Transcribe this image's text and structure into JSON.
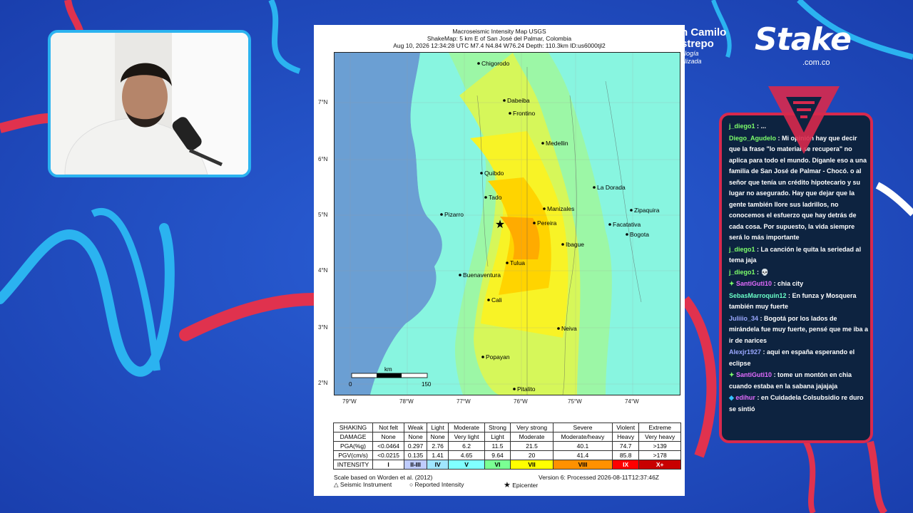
{
  "brand": {
    "name": "Juan Camilo Restrepo",
    "name_visible": "n Camilo\nstrepo",
    "sub": "ología\nalizada",
    "sponsor": "Stake",
    "sponsor_domain": ".com.co"
  },
  "map": {
    "title_lines": [
      "Macroseismic Intensity Map USGS",
      "ShakeMap: 5 km E of San José del Palmar, Colombia",
      "Aug 10, 2026 12:34:28 UTC M7.4 N4.84 W76.24 Depth: 110.3km ID:us6000tjl2"
    ],
    "lat_labels": [
      "7°N",
      "6°N",
      "5°N",
      "4°N",
      "3°N",
      "2°N"
    ],
    "lon_labels": [
      "79°W",
      "78°W",
      "77°W",
      "76°W",
      "75°W",
      "74°W"
    ],
    "scale": {
      "unit": "km",
      "min": "0",
      "max": "150"
    },
    "cities": [
      "Chigorodo",
      "Dabeiba",
      "Frontino",
      "Medellin",
      "Quibdo",
      "La Dorada",
      "Tado",
      "Manizales",
      "Zipaquira",
      "Pizarro",
      "Pereira",
      "Facatativa",
      "Bogota",
      "Ibague",
      "Tulua",
      "Buenaventura",
      "Cali",
      "Neiva",
      "Popayan",
      "Pitalito"
    ],
    "legend": {
      "shaking": [
        "SHAKING",
        "Not felt",
        "Weak",
        "Light",
        "Moderate",
        "Strong",
        "Very strong",
        "Severe",
        "Violent",
        "Extreme"
      ],
      "damage": [
        "DAMAGE",
        "None",
        "None",
        "None",
        "Very light",
        "Light",
        "Moderate",
        "Moderate/heavy",
        "Heavy",
        "Very heavy"
      ],
      "pga": [
        "PGA(%g)",
        "<0.0464",
        "0.297",
        "2.76",
        "6.2",
        "11.5",
        "21.5",
        "40.1",
        "74.7",
        ">139"
      ],
      "pgv": [
        "PGV(cm/s)",
        "<0.0215",
        "0.135",
        "1.41",
        "4.65",
        "9.64",
        "20",
        "41.4",
        "85.8",
        ">178"
      ],
      "intensity": [
        "INTENSITY",
        "I",
        "II-III",
        "IV",
        "V",
        "VI",
        "VII",
        "VIII",
        "IX",
        "X+"
      ],
      "intensity_colors": [
        "#ffffff",
        "#ffffff",
        "#bfccff",
        "#a0e6ff",
        "#80ffff",
        "#7aff93",
        "#ffff00",
        "#ffc800",
        "#ff9100",
        "#ff0000",
        "#c80000"
      ]
    },
    "footer": {
      "scale_note": "Scale based on Worden et al. (2012)",
      "version": "Version 6: Processed 2026-08-11T12:37:46Z",
      "seismic": "Seismic Instrument",
      "reported": "Reported Intensity",
      "epicenter": "Epicenter"
    }
  },
  "chat": {
    "messages": [
      {
        "user": "j_diego1",
        "text": ": ...",
        "color": "#7dff6b"
      },
      {
        "user": "Diego_Agudelo",
        "text": ": Mi opinión hay que decir que la frase \"lo material se recupera\" no aplica para todo el mundo. Díganle eso a una familia de San José de Palmar - Chocó. o al señor que tenía un crédito hipotecario y su lugar no asegurado. Hay que dejar que la gente también llore sus ladrillos, no conocemos el esfuerzo que hay detrás de cada cosa. Por supuesto, la vida siempre será lo más importante",
        "color": "#7dff6b"
      },
      {
        "user": "j_diego1",
        "text": ": La canción le quita la seriedad al tema jaja",
        "color": "#7dff6b"
      },
      {
        "user": "j_diego1",
        "text": ": 💀",
        "color": "#7dff6b"
      },
      {
        "user": "SantiGuti10",
        "text": ": chia city",
        "color": "#e36bff",
        "badge": "✦"
      },
      {
        "user": "SebasMarroquin12",
        "text": ": En funza y Mosquera también muy fuerte",
        "color": "#6bffc8"
      },
      {
        "user": "Juliiio_34",
        "text": ": Bogotá por los lados de mirándela fue muy fuerte, pensé que me iba a ir de narices",
        "color": "#9aa8ff"
      },
      {
        "user": "Alexjr1927",
        "text": ": aqui en españa esperando el eclipse",
        "color": "#9aa8ff"
      },
      {
        "user": "SantiGuti10",
        "text": ": tome un montón en chia cuando estaba en la sabana jajajaja",
        "color": "#e36bff",
        "badge": "✦"
      },
      {
        "user": "edihur",
        "text": ": en Cuidadela Colsubsidio re duro se sintió",
        "color": "#e36bff",
        "badge": "◆"
      }
    ]
  }
}
